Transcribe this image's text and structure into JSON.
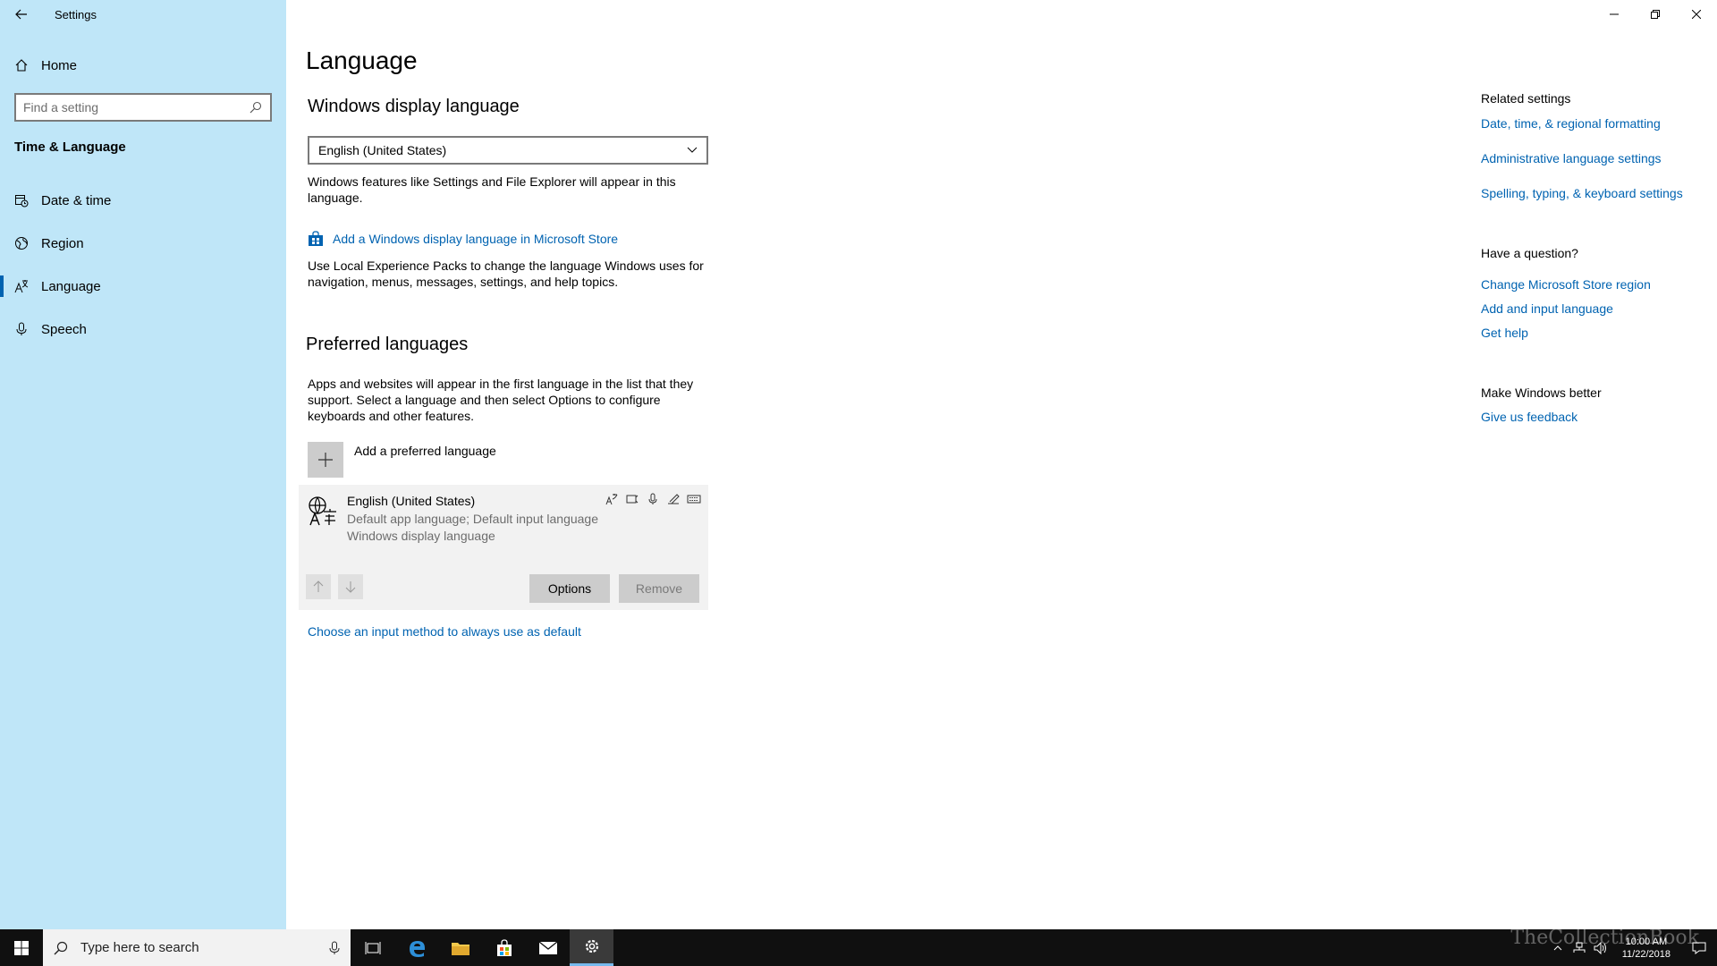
{
  "window": {
    "title": "Settings"
  },
  "sidebar": {
    "home_label": "Home",
    "search_placeholder": "Find a setting",
    "section_title": "Time & Language",
    "items": [
      {
        "label": "Date & time",
        "icon": "calendar-clock-icon"
      },
      {
        "label": "Region",
        "icon": "globe-icon"
      },
      {
        "label": "Language",
        "icon": "language-icon",
        "selected": true
      },
      {
        "label": "Speech",
        "icon": "microphone-icon"
      }
    ]
  },
  "main": {
    "page_title": "Language",
    "display_language": {
      "heading": "Windows display language",
      "selected_value": "English (United States)",
      "description": "Windows features like Settings and File Explorer will appear in this language.",
      "store_link": "Add a Windows display language in Microsoft Store",
      "lxp_description": "Use Local Experience Packs to change the language Windows uses for navigation, menus, messages, settings, and help topics."
    },
    "preferred": {
      "heading": "Preferred languages",
      "description": "Apps and websites will appear in the first language in the list that they support. Select a language and then select Options to configure keyboards and other features.",
      "add_label": "Add a preferred language",
      "language": {
        "name": "English (United States)",
        "line1": "Default app language; Default input language",
        "line2": "Windows display language"
      },
      "options_label": "Options",
      "remove_label": "Remove",
      "input_method_link": "Choose an input method to always use as default"
    }
  },
  "related": {
    "heading": "Related settings",
    "links": [
      "Date, time, & regional formatting",
      "Administrative language settings",
      "Spelling, typing, & keyboard settings"
    ],
    "question_heading": "Have a question?",
    "question_links": [
      "Change Microsoft Store region",
      "Add and input language",
      "Get help"
    ],
    "better_heading": "Make Windows better",
    "feedback_link": "Give us feedback"
  },
  "taskbar": {
    "search_placeholder": "Type here to search",
    "time": "10:00 AM",
    "date": "11/22/2018",
    "watermark": "TheCollectionBook"
  },
  "colors": {
    "sidebar_bg": "#bfe6f8",
    "accent": "#0063b1",
    "taskbar_bg": "#101010"
  }
}
